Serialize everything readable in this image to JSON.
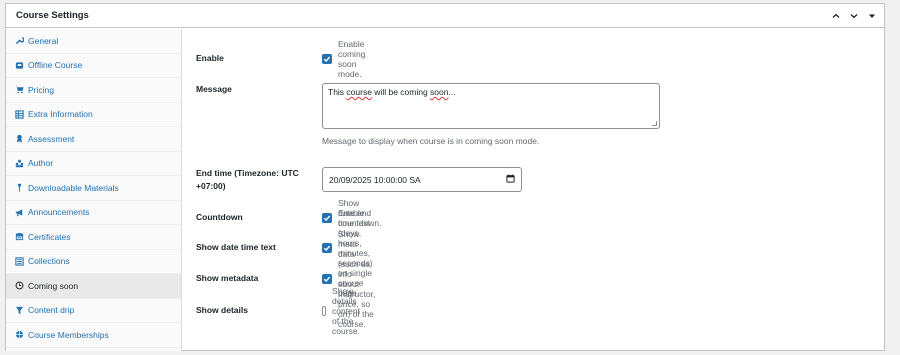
{
  "metabox": {
    "title": "Course Settings",
    "controls": [
      "chevron-up-icon",
      "chevron-down-icon",
      "triangle-down-icon"
    ]
  },
  "sidebar": {
    "items": [
      {
        "label": "General",
        "icon": "wrench-icon",
        "active": false
      },
      {
        "label": "Offline Course",
        "icon": "offline-icon",
        "active": false
      },
      {
        "label": "Pricing",
        "icon": "cart-icon",
        "active": false
      },
      {
        "label": "Extra Information",
        "icon": "info-table-icon",
        "active": false
      },
      {
        "label": "Assessment",
        "icon": "award-icon",
        "active": false
      },
      {
        "label": "Author",
        "icon": "users-icon",
        "active": false
      },
      {
        "label": "Downloadable Materials",
        "icon": "download-icon",
        "active": false
      },
      {
        "label": "Announcements",
        "icon": "megaphone-icon",
        "active": false
      },
      {
        "label": "Certificates",
        "icon": "certificate-icon",
        "active": false
      },
      {
        "label": "Collections",
        "icon": "list-icon",
        "active": false
      },
      {
        "label": "Coming soon",
        "icon": "clock-icon",
        "active": true
      },
      {
        "label": "Content drip",
        "icon": "filter-icon",
        "active": false
      },
      {
        "label": "Course Memberships",
        "icon": "membership-icon",
        "active": false
      }
    ]
  },
  "settings": {
    "enable": {
      "label": "Enable",
      "text": "Enable coming soon mode.",
      "checked": true
    },
    "message": {
      "label": "Message",
      "value_start": "This ",
      "value_word": "course",
      "value_mid": " will be coming ",
      "value_word2": "soon",
      "value_end": "...",
      "help": "Message to display when course is in coming soon mode."
    },
    "end_time": {
      "label": "End time (Timezone: UTC +07:00)",
      "value": "20/09/2025 10:00:00 SA"
    },
    "countdown": {
      "label": "Countdown",
      "text": "Enable countdown.",
      "checked": true
    },
    "show_date_time": {
      "label": "Show date time text",
      "text": "Show date and time text (days, hours, minutes, seconds) on single course page.",
      "checked": true
    },
    "show_metadata": {
      "label": "Show metadata",
      "text": "Show meta data (such as info about Instructor, price, so on) of the course.",
      "checked": true
    },
    "show_details": {
      "label": "Show details",
      "text": "Show details content of the course.",
      "checked": false
    }
  },
  "colors": {
    "accent": "#2271b1",
    "active_bg": "#e9e9e9",
    "border": "#c3c4c7"
  }
}
